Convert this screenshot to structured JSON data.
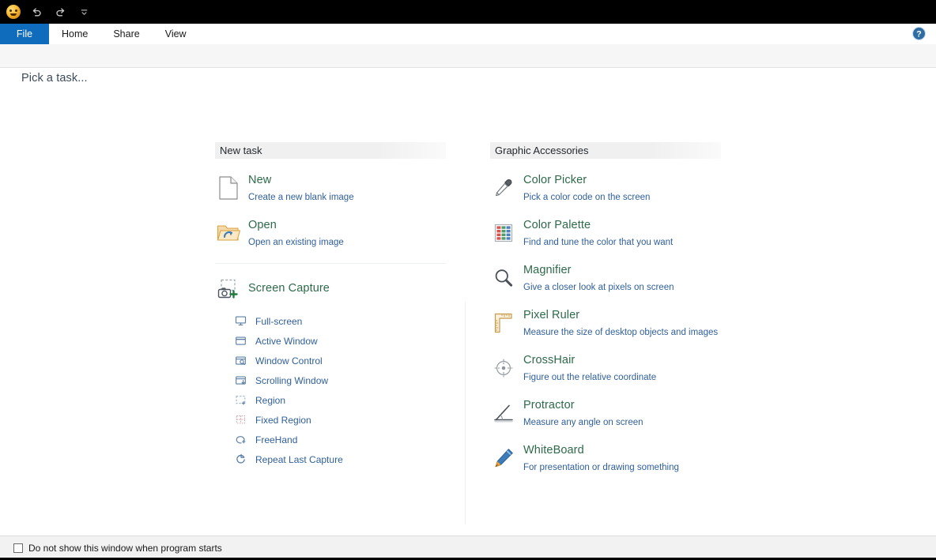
{
  "window": {
    "app_icon": "app-logo-icon",
    "quick_access": [
      {
        "name": "undo-icon",
        "label": "Undo"
      },
      {
        "name": "redo-icon",
        "label": "Redo"
      },
      {
        "name": "customize-quick-access-icon",
        "label": "Customize Quick Access Toolbar"
      }
    ]
  },
  "ribbon": {
    "tabs": [
      {
        "label": "File",
        "active": true
      },
      {
        "label": "Home",
        "active": false
      },
      {
        "label": "Share",
        "active": false
      },
      {
        "label": "View",
        "active": false
      }
    ],
    "help_icon": "help-icon",
    "accent_color": "#0f6cbd"
  },
  "backstage": {
    "prompt": "Pick a task...",
    "columns": [
      {
        "header": "New task",
        "entries": [
          {
            "icon": "new-document-icon",
            "title": "New",
            "subtitle": "Create a new blank image"
          },
          {
            "icon": "open-folder-icon",
            "title": "Open",
            "subtitle": "Open an existing image"
          }
        ],
        "group": {
          "icon": "screen-capture-icon",
          "title": "Screen Capture",
          "items": [
            {
              "icon": "full-screen-icon",
              "label": "Full-screen"
            },
            {
              "icon": "active-window-icon",
              "label": "Active Window"
            },
            {
              "icon": "window-control-icon",
              "label": "Window Control"
            },
            {
              "icon": "scrolling-window-icon",
              "label": "Scrolling Window"
            },
            {
              "icon": "region-icon",
              "label": "Region"
            },
            {
              "icon": "fixed-region-icon",
              "label": "Fixed Region"
            },
            {
              "icon": "freehand-icon",
              "label": "FreeHand"
            },
            {
              "icon": "repeat-last-capture-icon",
              "label": "Repeat Last Capture"
            }
          ]
        }
      },
      {
        "header": "Graphic Accessories",
        "entries": [
          {
            "icon": "color-picker-icon",
            "title": "Color Picker",
            "subtitle": "Pick a color code on the screen"
          },
          {
            "icon": "color-palette-icon",
            "title": "Color Palette",
            "subtitle": "Find and tune the color that you want"
          },
          {
            "icon": "magnifier-icon",
            "title": "Magnifier",
            "subtitle": "Give a closer look at pixels on screen"
          },
          {
            "icon": "pixel-ruler-icon",
            "title": "Pixel Ruler",
            "subtitle": "Measure the size of desktop objects and images"
          },
          {
            "icon": "crosshair-icon",
            "title": "CrossHair",
            "subtitle": "Figure out the relative coordinate"
          },
          {
            "icon": "protractor-icon",
            "title": "Protractor",
            "subtitle": "Measure any angle on screen"
          },
          {
            "icon": "whiteboard-icon",
            "title": "WhiteBoard",
            "subtitle": "For presentation or drawing something"
          }
        ]
      }
    ],
    "title_color": "#2d6a4a",
    "link_color": "#2f5f99"
  },
  "statusbar": {
    "checkbox_label": "Do not show this window when program starts",
    "checked": false
  }
}
